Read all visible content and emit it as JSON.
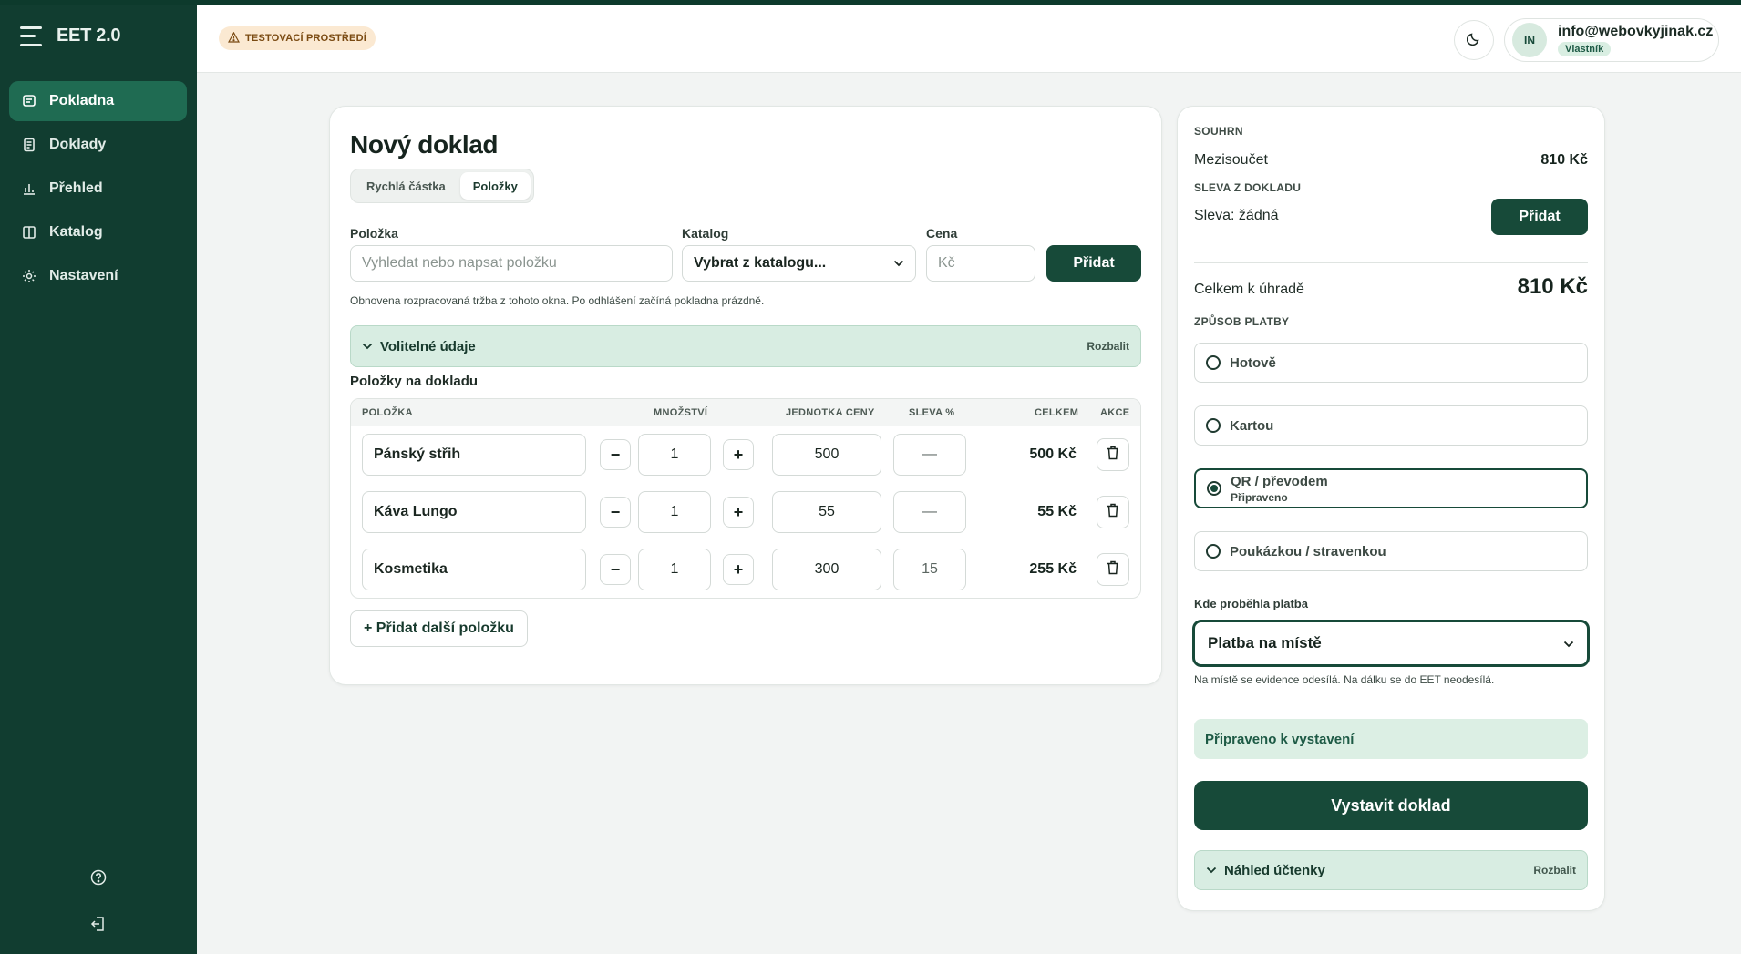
{
  "app": {
    "brand": "EET 2.0",
    "env_badge": "TESTOVACÍ PROSTŘEDÍ"
  },
  "sidebar": {
    "items": [
      {
        "label": "Pokladna",
        "icon": "receipt-icon",
        "active": true
      },
      {
        "label": "Doklady",
        "icon": "document-icon",
        "active": false
      },
      {
        "label": "Přehled",
        "icon": "bar-chart-icon",
        "active": false
      },
      {
        "label": "Katalog",
        "icon": "book-icon",
        "active": false
      },
      {
        "label": "Nastavení",
        "icon": "gear-icon",
        "active": false
      }
    ]
  },
  "user": {
    "initials": "IN",
    "email": "info@webovkyjinak.cz",
    "role": "Vlastník"
  },
  "main": {
    "title": "Nový doklad",
    "tabs": [
      {
        "label": "Rychlá částka",
        "active": false
      },
      {
        "label": "Položky",
        "active": true
      }
    ],
    "form": {
      "item_label": "Položka",
      "item_placeholder": "Vyhledat nebo napsat položku",
      "catalog_label": "Katalog",
      "catalog_value": "Vybrat z katalogu...",
      "price_label": "Cena",
      "price_placeholder": "Kč",
      "add_label": "Přidat"
    },
    "note": "Obnovena rozpracovaná tržba z tohoto okna. Po odhlášení začíná pokladna prázdně.",
    "optional": {
      "title": "Volitelné údaje",
      "action": "Rozbalit"
    },
    "items_title": "Položky na dokladu",
    "table": {
      "headers": [
        "POLOŽKA",
        "MNOŽSTVÍ",
        "JEDNOTKA CENY",
        "SLEVA %",
        "CELKEM",
        "AKCE"
      ],
      "rows": [
        {
          "name": "Pánský střih",
          "qty": "1",
          "unit_price": "500",
          "discount": "—",
          "total": "500 Kč"
        },
        {
          "name": "Káva Lungo",
          "qty": "1",
          "unit_price": "55",
          "discount": "—",
          "total": "55 Kč"
        },
        {
          "name": "Kosmetika",
          "qty": "1",
          "unit_price": "300",
          "discount": "15",
          "total": "255 Kč"
        }
      ],
      "minus": "−",
      "plus": "+"
    },
    "add_more_label": "+ Přidat další položku"
  },
  "summary": {
    "caption": "SOUHRN",
    "subtotal_label": "Mezisoučet",
    "subtotal_value": "810 Kč",
    "discount_caption": "SLEVA Z DOKLADU",
    "discount_text": "Sleva: žádná",
    "discount_add": "Přidat",
    "total_label": "Celkem k úhradě",
    "total_value": "810 Kč",
    "payment_caption": "ZPŮSOB PLATBY",
    "payment_options": [
      {
        "label": "Hotově",
        "sub": "",
        "selected": false
      },
      {
        "label": "Kartou",
        "sub": "",
        "selected": false
      },
      {
        "label": "QR / převodem",
        "sub": "Připraveno",
        "selected": true
      },
      {
        "label": "Poukázkou / stravenkou",
        "sub": "",
        "selected": false
      }
    ],
    "place_label": "Kde proběhla platba",
    "place_value": "Platba na místě",
    "place_note": "Na místě se evidence odesílá. Na dálku se do EET neodesílá.",
    "ready_text": "Připraveno k vystavení",
    "issue_label": "Vystavit doklad",
    "preview": {
      "title": "Náhled účtenky",
      "action": "Rozbalit"
    }
  },
  "colors": {
    "sidebar_bg": "#113d30",
    "accent": "#174a39",
    "active_nav": "#1f6b52",
    "mint": "#d8ede2"
  }
}
